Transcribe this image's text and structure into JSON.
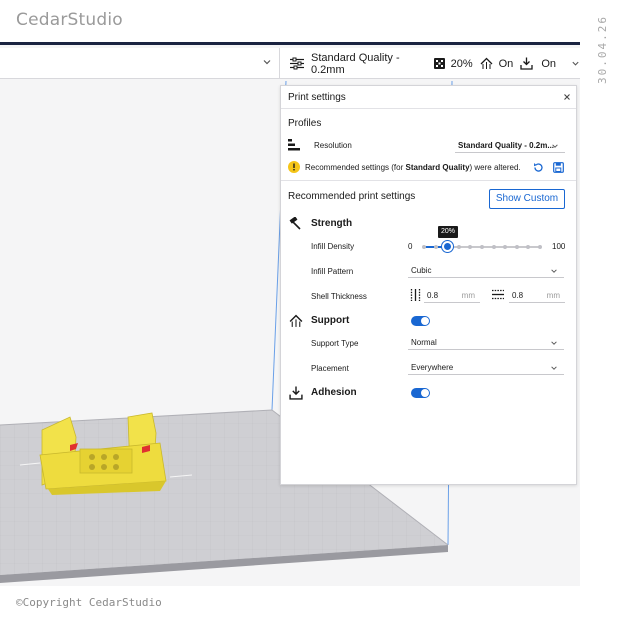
{
  "brand": "CedarStudio",
  "datestamp": "30.04.26",
  "copyright": "©Copyright CedarStudio",
  "toolbar": {
    "profile_summary": "Standard Quality - 0.2mm",
    "infill_value": "20%",
    "support_value": "On",
    "adhesion_value": "On"
  },
  "panel": {
    "title": "Print settings",
    "profiles_label": "Profiles",
    "resolution_label": "Resolution",
    "resolution_value": "Standard Quality - 0.2m...",
    "notice_prefix": "Recommended settings (for ",
    "notice_bold": "Standard Quality",
    "notice_suffix": ") were altered.",
    "recommended_label": "Recommended print settings",
    "show_custom_label": "Show Custom",
    "strength": {
      "title": "Strength",
      "infill_density_label": "Infill Density",
      "slider_min": "0",
      "slider_max": "100",
      "slider_value": 20,
      "slider_tooltip": "20%",
      "infill_pattern_label": "Infill Pattern",
      "infill_pattern_value": "Cubic",
      "shell_thickness_label": "Shell Thickness",
      "wall_thickness_value": "0.8",
      "top_bottom_thickness_value": "0.8",
      "unit": "mm"
    },
    "support": {
      "title": "Support",
      "enabled": true,
      "type_label": "Support Type",
      "type_value": "Normal",
      "placement_label": "Placement",
      "placement_value": "Everywhere"
    },
    "adhesion": {
      "title": "Adhesion",
      "enabled": true
    }
  },
  "colors": {
    "accent": "#1967d2",
    "header_bar": "#1a2340",
    "model_yellow": "#f2e24a",
    "warning": "#f5c518"
  }
}
